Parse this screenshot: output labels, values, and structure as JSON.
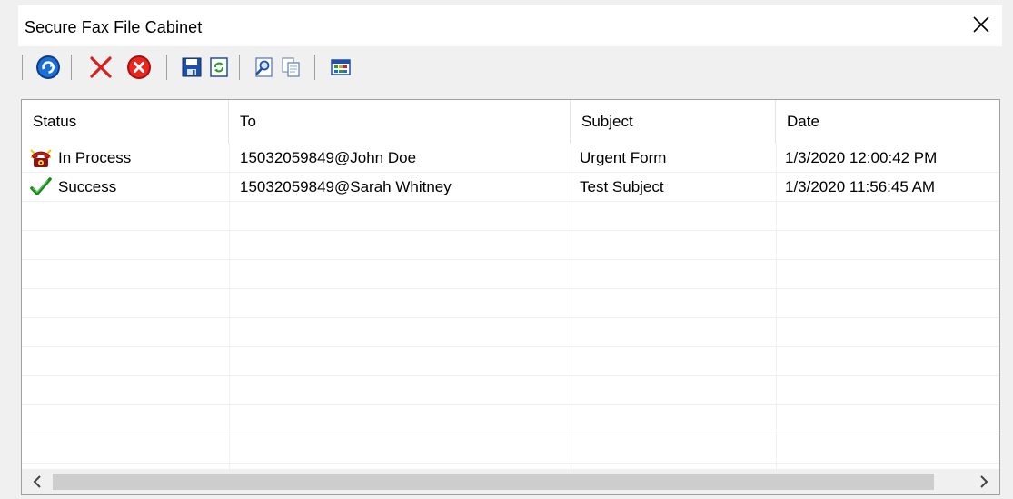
{
  "window": {
    "title": "Secure Fax File Cabinet"
  },
  "toolbar": {
    "buttons": [
      {
        "name": "refresh",
        "icon": "blue-refresh-icon"
      },
      {
        "name": "delete",
        "icon": "red-x-icon"
      },
      {
        "name": "cancel",
        "icon": "red-circle-x-icon"
      },
      {
        "name": "save",
        "icon": "floppy-disk-icon"
      },
      {
        "name": "resend",
        "icon": "recycle-document-icon"
      },
      {
        "name": "view",
        "icon": "magnify-document-icon"
      },
      {
        "name": "copy",
        "icon": "copy-documents-icon"
      },
      {
        "name": "columns",
        "icon": "grid-table-icon"
      }
    ]
  },
  "list": {
    "columns": [
      "Status",
      "To",
      "Subject",
      "Date"
    ],
    "rows": [
      {
        "status": "In Process",
        "status_icon": "fax-phone-icon",
        "to": "15032059849@John Doe",
        "subject": "Urgent Form",
        "date": "1/3/2020 12:00:42 PM"
      },
      {
        "status": "Success",
        "status_icon": "green-checkmark-icon",
        "to": "15032059849@Sarah Whitney",
        "subject": "Test Subject",
        "date": "1/3/2020 11:56:45 AM"
      }
    ]
  },
  "colors": {
    "accent_blue": "#1565c0",
    "delete_red": "#d81e1e",
    "success_green": "#168a16",
    "scroll_thumb": "#cdcdcd"
  }
}
